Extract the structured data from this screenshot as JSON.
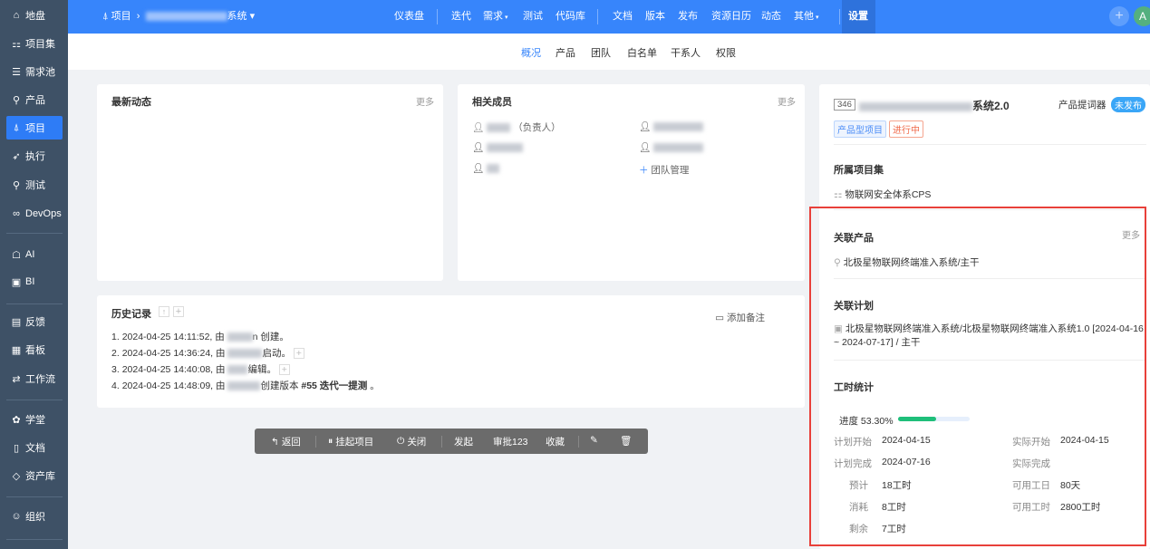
{
  "sidebar": {
    "items": [
      {
        "label": "地盘",
        "icon": "home-icon"
      },
      {
        "label": "项目集",
        "icon": "grid-icon"
      },
      {
        "label": "需求池",
        "icon": "list-icon"
      },
      {
        "label": "产品",
        "icon": "bulb-icon"
      },
      {
        "label": "项目",
        "icon": "rocket-icon"
      },
      {
        "label": "执行",
        "icon": "run-icon"
      },
      {
        "label": "测试",
        "icon": "search-icon"
      },
      {
        "label": "DevOps",
        "icon": "infinity-icon"
      },
      {
        "label": "AI",
        "icon": "robot-icon"
      },
      {
        "label": "BI",
        "icon": "chart-icon"
      },
      {
        "label": "反馈",
        "icon": "feedback-icon"
      },
      {
        "label": "看板",
        "icon": "kanban-icon"
      },
      {
        "label": "工作流",
        "icon": "workflow-icon"
      },
      {
        "label": "学堂",
        "icon": "school-icon"
      },
      {
        "label": "文档",
        "icon": "doc-icon"
      },
      {
        "label": "资产库",
        "icon": "diamond-icon"
      },
      {
        "label": "组织",
        "icon": "users-icon"
      }
    ],
    "active": "项目"
  },
  "header": {
    "section": "项目",
    "project_suffix": "系统",
    "nav": [
      "仪表盘",
      "迭代",
      "需求",
      "测试",
      "代码库",
      "文档",
      "版本",
      "发布",
      "资源日历",
      "动态",
      "其他",
      "设置"
    ],
    "avatar": "A"
  },
  "subnav": [
    "概况",
    "产品",
    "团队",
    "白名单",
    "干系人",
    "权限"
  ],
  "latest": {
    "title": "最新动态",
    "more": "更多"
  },
  "members": {
    "title": "相关成员",
    "more": "更多",
    "owner_suffix": "（负责人）",
    "manage": "团队管理"
  },
  "history": {
    "title": "历史记录",
    "add_note": "添加备注",
    "entries": [
      {
        "n": "1.",
        "time": "2024-04-25 14:11:52, 由",
        "action": "n 创建。"
      },
      {
        "n": "2.",
        "time": "2024-04-25 14:36:24, 由",
        "action": "启动。"
      },
      {
        "n": "3.",
        "time": "2024-04-25 14:40:08, 由",
        "action": "编辑。"
      },
      {
        "n": "4.",
        "time": "2024-04-25 14:48:09, 由",
        "action": "创建版本",
        "build": "#55 迭代一提测",
        "end": "。"
      }
    ]
  },
  "toolbar": {
    "back": "返回",
    "suspend": "挂起项目",
    "close": "关闭",
    "initiate": "发起",
    "approve": "审批123",
    "favorite": "收藏"
  },
  "project": {
    "id": "346",
    "name_suffix": "系统2.0",
    "product_label": "产品提词器",
    "release_badge": "未发布",
    "type_tag": "产品型项目",
    "status_tag": "进行中",
    "program_title": "所属项目集",
    "program": "物联网安全体系CPS",
    "products_title": "关联产品",
    "products_more": "更多",
    "product": "北极星物联网终端准入系统/主干",
    "plans_title": "关联计划",
    "plan": "北极星物联网终端准入系统/北极星物联网终端准入系统1.0 [2024-04-16 ~ 2024-07-17] / 主干",
    "hours_title": "工时统计",
    "progress_label": "进度 53.30%",
    "progress": 53.3,
    "stats": [
      {
        "l": "计划开始",
        "v": "2024-04-15",
        "l2": "实际开始",
        "v2": "2024-04-15"
      },
      {
        "l": "计划完成",
        "v": "2024-07-16",
        "l2": "实际完成",
        "v2": ""
      },
      {
        "l": "预计",
        "v": "18工时",
        "l2": "可用工日",
        "v2": "80天"
      },
      {
        "l": "消耗",
        "v": "8工时",
        "l2": "可用工时",
        "v2": "2800工时"
      },
      {
        "l": "剩余",
        "v": "7工时",
        "l2": "",
        "v2": ""
      }
    ]
  },
  "colors": {
    "primary": "#3785fb",
    "sidebar": "#3e5166",
    "progress": "#1fbf7a",
    "highlight": "#e8403a"
  }
}
